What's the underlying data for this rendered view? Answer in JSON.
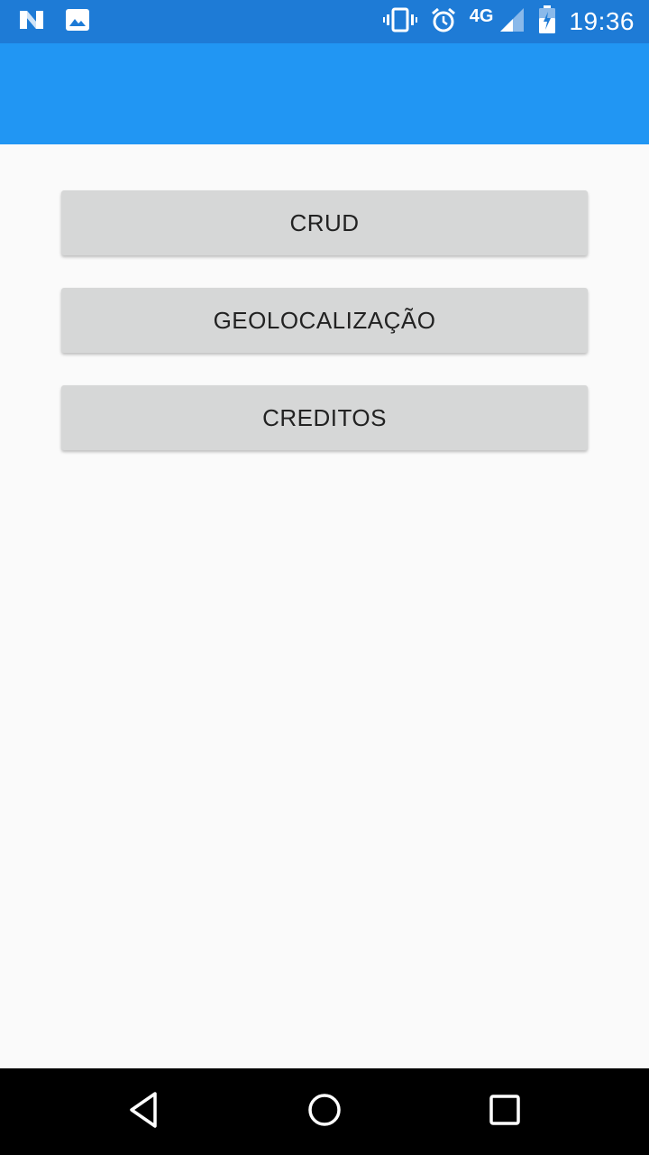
{
  "status_bar": {
    "time": "19:36",
    "network_type": "4G",
    "left_icons": [
      "notification-n-icon",
      "image-icon"
    ],
    "right_icons": [
      "vibrate-icon",
      "alarm-icon",
      "signal-icon",
      "battery-charging-icon"
    ]
  },
  "app_bar": {
    "color": "#2196f3"
  },
  "menu": {
    "buttons": [
      {
        "label": "CRUD"
      },
      {
        "label": "GEOLOCALIZAÇÃO"
      },
      {
        "label": "CREDITOS"
      }
    ]
  },
  "nav_bar": {
    "buttons": [
      "back-icon",
      "home-icon",
      "recents-icon"
    ]
  }
}
